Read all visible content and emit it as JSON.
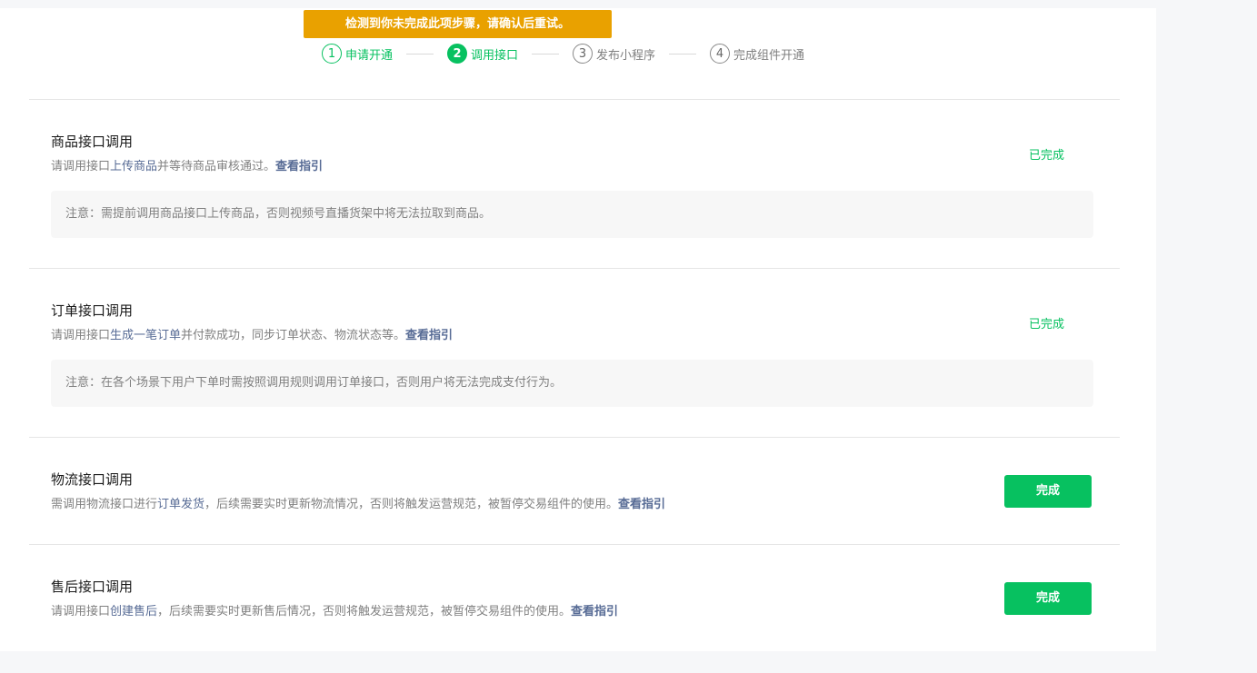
{
  "toast": "检测到你未完成此项步骤，请确认后重试。",
  "steps": [
    {
      "num": "1",
      "label": "申请开通"
    },
    {
      "num": "2",
      "label": "调用接口"
    },
    {
      "num": "3",
      "label": "发布小程序"
    },
    {
      "num": "4",
      "label": "完成组件开通"
    }
  ],
  "sections": [
    {
      "title": "商品接口调用",
      "desc_pre": "请调用接口",
      "desc_link": "上传商品",
      "desc_post": "并等待商品审核通过。",
      "guide": "查看指引",
      "note": "注意：需提前调用商品接口上传商品，否则视频号直播货架中将无法拉取到商品。",
      "status": "已完成"
    },
    {
      "title": "订单接口调用",
      "desc_pre": "请调用接口",
      "desc_link": "生成一笔订单",
      "desc_post": "并付款成功，同步订单状态、物流状态等。",
      "guide": "查看指引",
      "note": "注意：在各个场景下用户下单时需按照调用规则调用订单接口，否则用户将无法完成支付行为。",
      "status": "已完成"
    },
    {
      "title": "物流接口调用",
      "desc_pre": "需调用物流接口进行",
      "desc_link": "订单发货",
      "desc_post": "，后续需要实时更新物流情况，否则将触发运营规范，被暂停交易组件的使用。",
      "guide": "查看指引",
      "button": "完成"
    },
    {
      "title": "售后接口调用",
      "desc_pre": "请调用接口",
      "desc_link": "创建售后",
      "desc_post": "，后续需要实时更新售后情况，否则将触发运营规范，被暂停交易组件的使用。",
      "guide": "查看指引",
      "button": "完成"
    }
  ]
}
